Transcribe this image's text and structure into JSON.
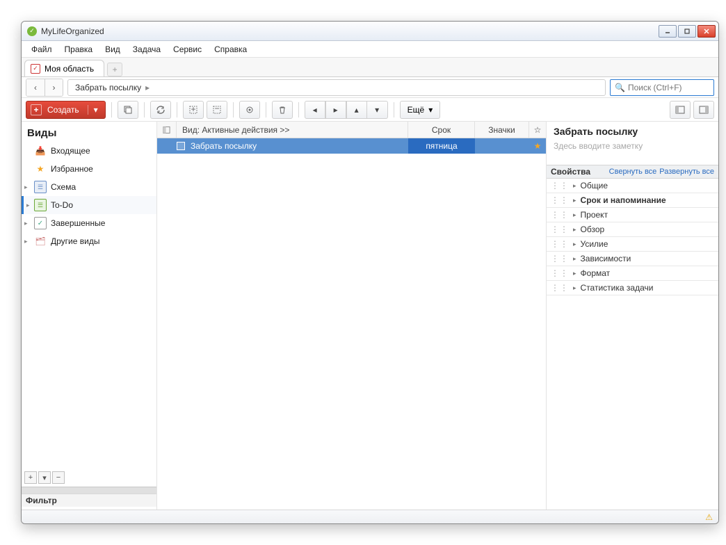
{
  "window": {
    "title": "MyLifeOrganized"
  },
  "menu": {
    "file": "Файл",
    "edit": "Правка",
    "view": "Вид",
    "task": "Задача",
    "service": "Сервис",
    "help": "Справка"
  },
  "tab": {
    "label": "Моя область"
  },
  "breadcrumb": {
    "item": "Забрать посылку"
  },
  "search": {
    "placeholder": "Поиск (Ctrl+F)"
  },
  "toolbar": {
    "create": "Создать",
    "more": "Ещё"
  },
  "sidebar": {
    "heading": "Виды",
    "inbox": "Входящее",
    "favorites": "Избранное",
    "outline": "Схема",
    "todo": "To-Do",
    "completed": "Завершенные",
    "other": "Другие виды",
    "filter": "Фильтр"
  },
  "list": {
    "view_label": "Вид: Активные действия >>",
    "col_due": "Срок",
    "col_flags": "Значки",
    "task_name": "Забрать посылку",
    "task_due": "пятница"
  },
  "details": {
    "title": "Забрать посылку",
    "note_placeholder": "Здесь вводите заметку",
    "props_title": "Свойства",
    "collapse": "Свернуть все",
    "expand": "Развернуть все",
    "sections": {
      "general": "Общие",
      "due": "Срок и напоминание",
      "project": "Проект",
      "review": "Обзор",
      "effort": "Усилие",
      "deps": "Зависимости",
      "format": "Формат",
      "stats": "Статистика задачи"
    }
  }
}
